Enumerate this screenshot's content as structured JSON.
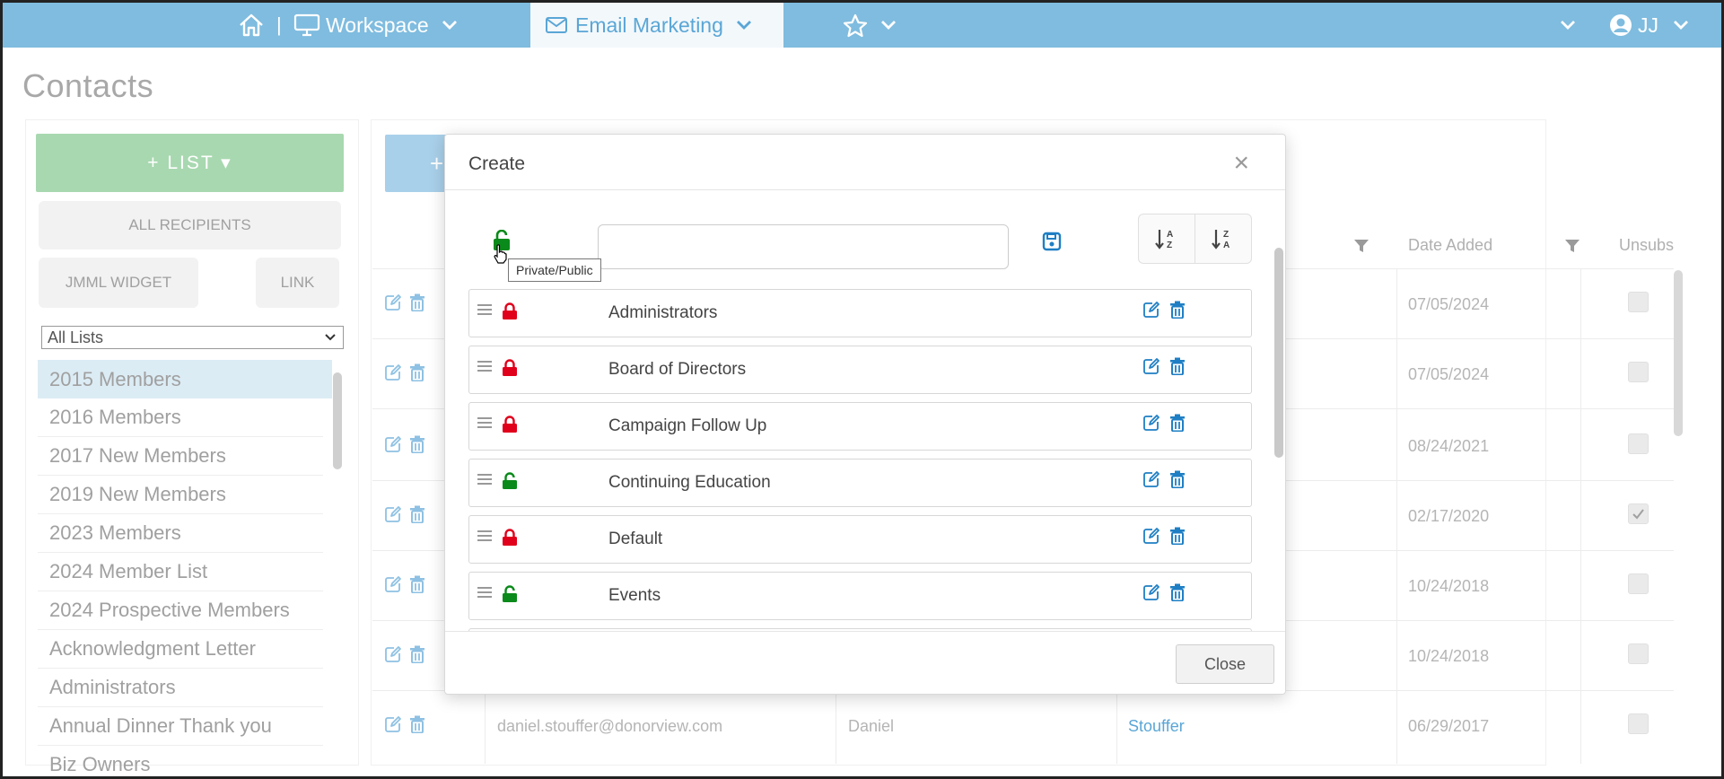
{
  "nav": {
    "workspace_label": "Workspace",
    "email_marketing_label": "Email Marketing",
    "separator": "|",
    "user_initials": "JJ"
  },
  "page": {
    "title": "Contacts"
  },
  "sidebar": {
    "add_list_label": "+ LIST ▾",
    "all_recipients_label": "ALL RECIPIENTS",
    "jmml_widget_label": "JMML WIDGET",
    "link_label": "LINK",
    "list_filter_value": "All Lists",
    "lists": [
      "2015 Members",
      "2016 Members",
      "2017 New Members",
      "2019 New Members",
      "2023 Members",
      "2024 Member List",
      "2024 Prospective Members",
      "Acknowledgment Letter",
      "Administrators",
      "Annual Dinner Thank you",
      "Biz Owners"
    ]
  },
  "table": {
    "headers": {
      "date_added": "Date Added",
      "unsubscribed": "Unsubs"
    },
    "rows": [
      {
        "email": "",
        "first": "",
        "last": "",
        "date": "07/05/2024",
        "unsub": false
      },
      {
        "email": "",
        "first": "",
        "last": "",
        "date": "07/05/2024",
        "unsub": false
      },
      {
        "email": "",
        "first": "",
        "last": "",
        "date": "08/24/2021",
        "unsub": false
      },
      {
        "email": "",
        "first": "",
        "last": "",
        "date": "02/17/2020",
        "unsub": true
      },
      {
        "email": "",
        "first": "",
        "last": "",
        "date": "10/24/2018",
        "unsub": false
      },
      {
        "email": "",
        "first": "",
        "last": "",
        "date": "10/24/2018",
        "unsub": false
      },
      {
        "email": "daniel.stouffer@donorview.com",
        "first": "Daniel",
        "last": "Stouffer",
        "date": "06/29/2017",
        "unsub": false
      }
    ]
  },
  "modal": {
    "title": "Create",
    "close_symbol": "×",
    "close_button_label": "Close",
    "name_input_value": "",
    "tooltip": "Private/Public",
    "lists": [
      {
        "name": "Administrators",
        "status": "private"
      },
      {
        "name": "Board of Directors",
        "status": "private"
      },
      {
        "name": "Campaign Follow Up",
        "status": "private"
      },
      {
        "name": "Continuing Education",
        "status": "public"
      },
      {
        "name": "Default",
        "status": "private"
      },
      {
        "name": "Events",
        "status": "public"
      }
    ]
  },
  "colors": {
    "nav_bg": "#7fbcdf",
    "private_lock": "#e0001b",
    "public_lock": "#0a8a1a",
    "action_blue": "#1f7fc4",
    "link_blue": "#5aa6d6"
  }
}
